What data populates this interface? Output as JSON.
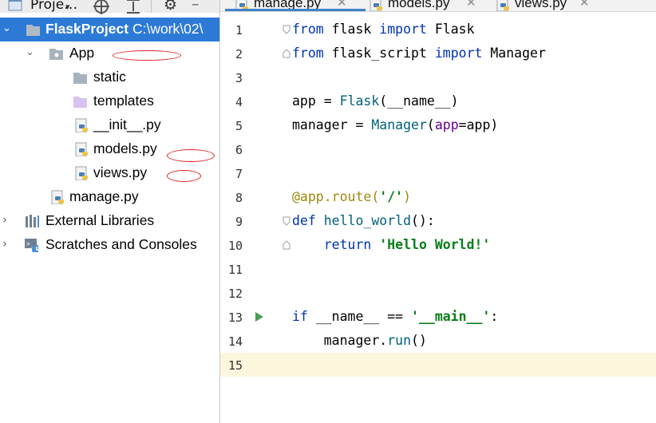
{
  "project_panel": {
    "title": "Proje…",
    "tree": [
      {
        "label": "FlaskProject",
        "path": "C:\\work\\02\\",
        "icon": "folder-icon",
        "selected": true
      },
      {
        "label": "App",
        "icon": "package-folder-icon"
      },
      {
        "label": "static",
        "icon": "folder-icon"
      },
      {
        "label": "templates",
        "icon": "templates-folder-icon"
      },
      {
        "label": "__init__.py",
        "icon": "python-file-icon"
      },
      {
        "label": "models.py",
        "icon": "python-file-icon"
      },
      {
        "label": "views.py",
        "icon": "python-file-icon"
      },
      {
        "label": "manage.py",
        "icon": "python-file-icon"
      },
      {
        "label": "External Libraries",
        "icon": "libraries-icon"
      },
      {
        "label": "Scratches and Consoles",
        "icon": "scratches-icon"
      }
    ]
  },
  "editor": {
    "tabs": [
      {
        "label": "manage.py",
        "active": true
      },
      {
        "label": "models.py",
        "active": false
      },
      {
        "label": "views.py",
        "active": false
      }
    ],
    "line_numbers": [
      "1",
      "2",
      "3",
      "4",
      "5",
      "6",
      "7",
      "8",
      "9",
      "10",
      "11",
      "12",
      "13",
      "14",
      "15"
    ],
    "code": {
      "l1_from": "from",
      "l1_mod": " flask ",
      "l1_import": "import",
      "l1_name": " Flask",
      "l2_from": "from",
      "l2_mod": " flask_script ",
      "l2_import": "import",
      "l2_name": " Manager",
      "l4_a": "app = ",
      "l4_call": "Flask",
      "l4_b": "(__name__)",
      "l5_a": "manager = ",
      "l5_call": "Manager",
      "l5_b": "(",
      "l5_param": "app",
      "l5_c": "=app)",
      "l8_dec": "@app.route(",
      "l8_str": "'/'",
      "l8_end": ")",
      "l9_def": "def",
      "l9_sp": " ",
      "l9_fn": "hello_world",
      "l9_end": "():",
      "l10_indent": "    ",
      "l10_return": "return",
      "l10_sp": " ",
      "l10_str": "'Hello World!'",
      "l13_if": "if",
      "l13_mid": " __name__ == ",
      "l13_str": "'__main__'",
      "l13_end": ":",
      "l14_a": "    manager.",
      "l14_call": "run",
      "l14_b": "()"
    }
  },
  "colors": {
    "selection": "#2d7ad6",
    "keyword": "#0033b3",
    "string": "#067d17",
    "decorator": "#9e880d",
    "current_line": "#fcf6dc",
    "annotation_mark": "#e02020"
  }
}
